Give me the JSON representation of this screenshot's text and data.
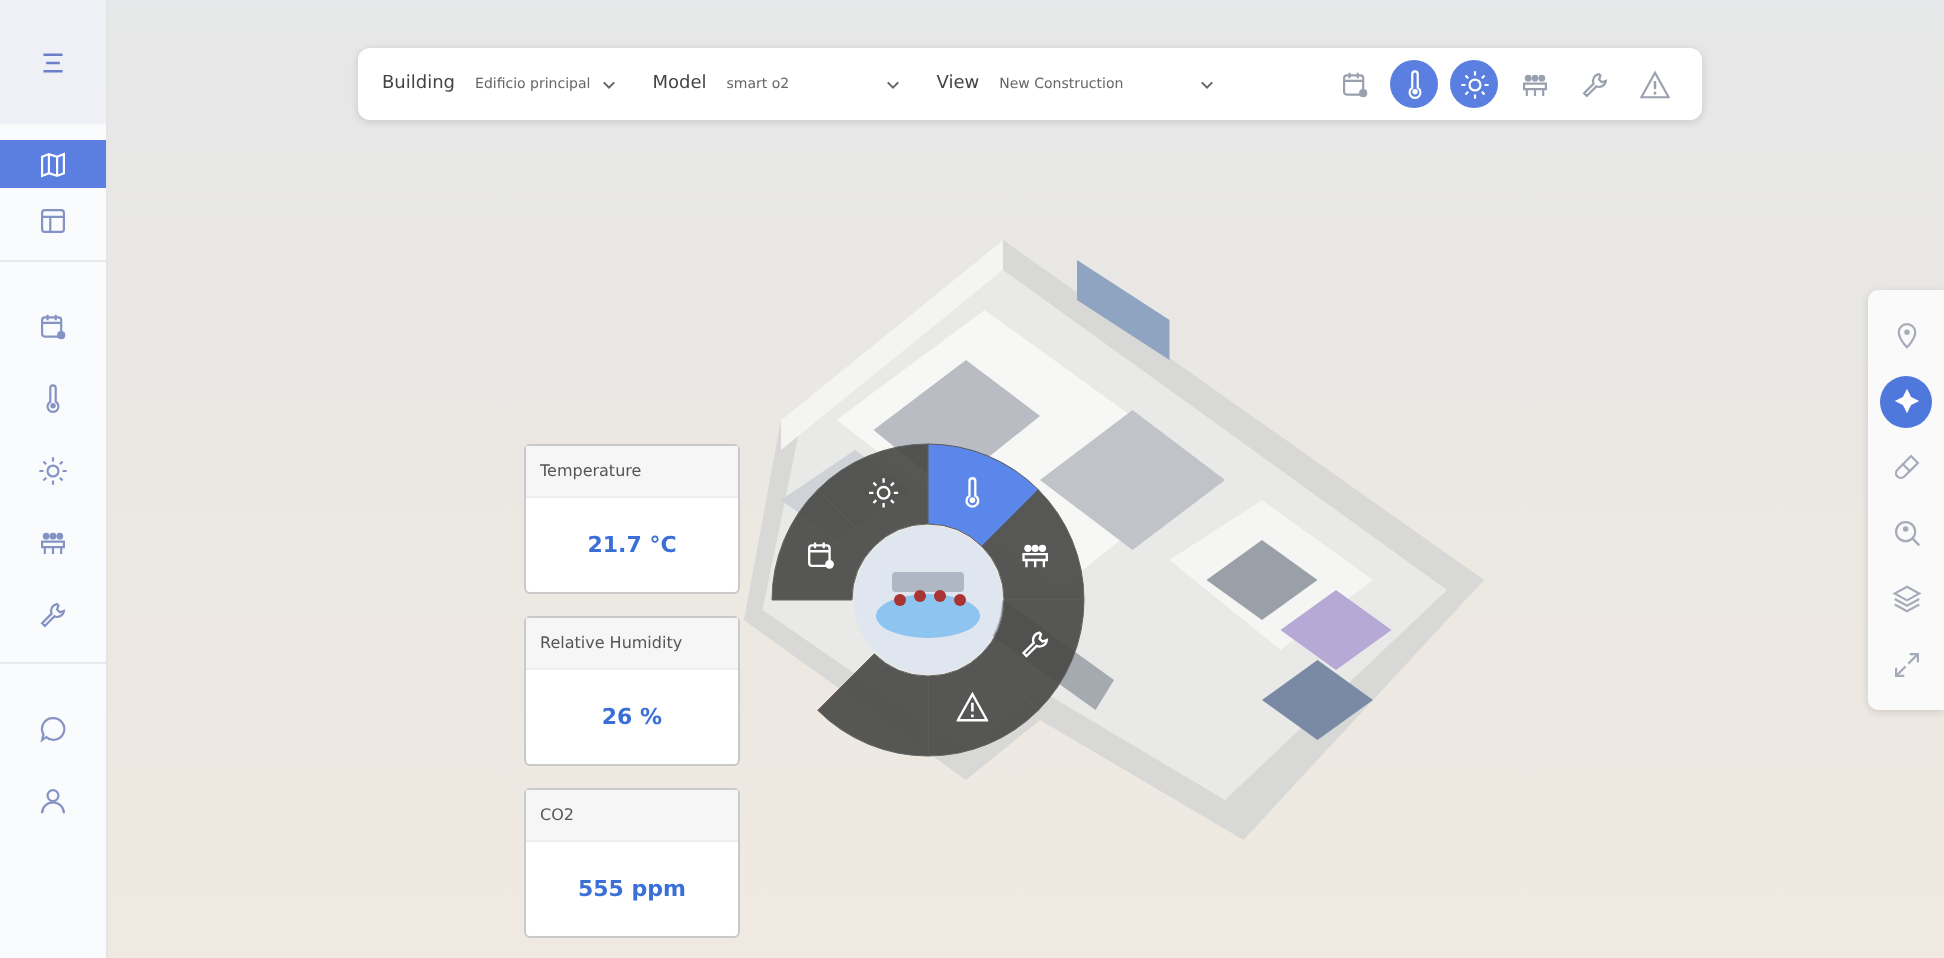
{
  "sidebar": {
    "items": [
      {
        "selected": true
      },
      {
        "selected": false
      },
      {
        "selected": false
      },
      {
        "selected": false
      },
      {
        "selected": false
      },
      {
        "selected": false
      },
      {
        "selected": false
      },
      {
        "selected": false
      },
      {
        "selected": false
      }
    ]
  },
  "toolbar": {
    "filters": [
      {
        "label": "Building",
        "value": "Edificio principal"
      },
      {
        "label": "Model",
        "value": "smart o2"
      },
      {
        "label": "View",
        "value": "New Construction"
      }
    ],
    "layers": [
      {
        "selected": false
      },
      {
        "selected": true
      },
      {
        "selected": true
      },
      {
        "selected": false
      },
      {
        "selected": false
      },
      {
        "selected": false
      }
    ]
  },
  "right_tools": [
    {
      "selected": false
    },
    {
      "selected": true
    },
    {
      "selected": false
    },
    {
      "selected": false
    },
    {
      "selected": false
    },
    {
      "selected": false
    }
  ],
  "radial_menu": [
    {
      "selected": false
    },
    {
      "selected": false
    },
    {
      "selected": true
    },
    {
      "selected": false
    },
    {
      "selected": false
    },
    {
      "selected": false
    }
  ],
  "sensor_cards": [
    {
      "title": "Temperature",
      "value": "21.7 °C"
    },
    {
      "title": "Relative Humidity",
      "value": "26 %"
    },
    {
      "title": "CO2",
      "value": "555 ppm"
    }
  ]
}
